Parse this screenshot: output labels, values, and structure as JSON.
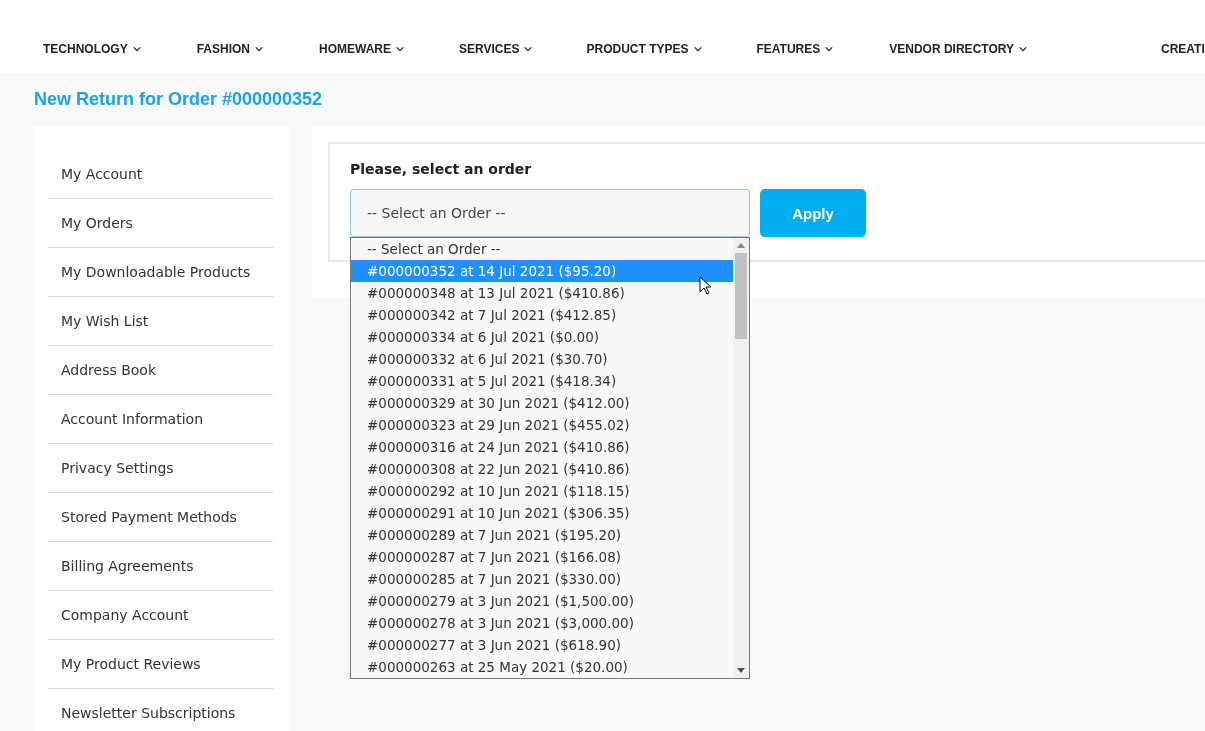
{
  "nav": [
    {
      "label": "TECHNOLOGY",
      "dropdown": true
    },
    {
      "label": "FASHION",
      "dropdown": true
    },
    {
      "label": "HOMEWARE",
      "dropdown": true
    },
    {
      "label": "SERVICES",
      "dropdown": true
    },
    {
      "label": "PRODUCT TYPES",
      "dropdown": true
    },
    {
      "label": "FEATURES",
      "dropdown": true
    },
    {
      "label": "VENDOR DIRECTORY",
      "dropdown": true
    },
    {
      "label": "CREATI",
      "dropdown": false
    }
  ],
  "page_title": "New Return for Order #000000352",
  "sidebar": {
    "items": [
      {
        "label": "My Account"
      },
      {
        "label": "My Orders"
      },
      {
        "label": "My Downloadable Products"
      },
      {
        "label": "My Wish List"
      },
      {
        "label": "Address Book"
      },
      {
        "label": "Account Information"
      },
      {
        "label": "Privacy Settings"
      },
      {
        "label": "Stored Payment Methods"
      },
      {
        "label": "Billing Agreements"
      },
      {
        "label": "Company Account"
      },
      {
        "label": "My Product Reviews"
      },
      {
        "label": "Newsletter Subscriptions"
      }
    ]
  },
  "order_form": {
    "label": "Please, select an order",
    "select_value": "-- Select an Order --",
    "apply_button": "Apply",
    "options": [
      {
        "label": "-- Select an Order --",
        "selected": false
      },
      {
        "label": "#000000352 at 14 Jul 2021 ($95.20)",
        "selected": true
      },
      {
        "label": "#000000348 at 13 Jul 2021 ($410.86)",
        "selected": false
      },
      {
        "label": "#000000342 at 7 Jul 2021 ($412.85)",
        "selected": false
      },
      {
        "label": "#000000334 at 6 Jul 2021 ($0.00)",
        "selected": false
      },
      {
        "label": "#000000332 at 6 Jul 2021 ($30.70)",
        "selected": false
      },
      {
        "label": "#000000331 at 5 Jul 2021 ($418.34)",
        "selected": false
      },
      {
        "label": "#000000329 at 30 Jun 2021 ($412.00)",
        "selected": false
      },
      {
        "label": "#000000323 at 29 Jun 2021 ($455.02)",
        "selected": false
      },
      {
        "label": "#000000316 at 24 Jun 2021 ($410.86)",
        "selected": false
      },
      {
        "label": "#000000308 at 22 Jun 2021 ($410.86)",
        "selected": false
      },
      {
        "label": "#000000292 at 10 Jun 2021 ($118.15)",
        "selected": false
      },
      {
        "label": "#000000291 at 10 Jun 2021 ($306.35)",
        "selected": false
      },
      {
        "label": "#000000289 at 7 Jun 2021 ($195.20)",
        "selected": false
      },
      {
        "label": "#000000287 at 7 Jun 2021 ($166.08)",
        "selected": false
      },
      {
        "label": "#000000285 at 7 Jun 2021 ($330.00)",
        "selected": false
      },
      {
        "label": "#000000279 at 3 Jun 2021 ($1,500.00)",
        "selected": false
      },
      {
        "label": "#000000278 at 3 Jun 2021 ($3,000.00)",
        "selected": false
      },
      {
        "label": "#000000277 at 3 Jun 2021 ($618.90)",
        "selected": false
      },
      {
        "label": "#000000263 at 25 May 2021 ($20.00)",
        "selected": false
      }
    ]
  }
}
